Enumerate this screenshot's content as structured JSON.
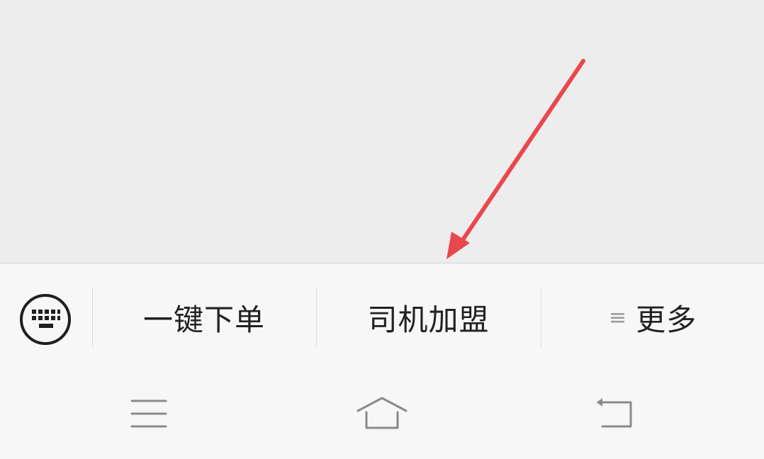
{
  "menu": {
    "items": [
      {
        "label": "一键下单"
      },
      {
        "label": "司机加盟"
      },
      {
        "label": "更多",
        "icon": "list-icon",
        "icon_glyph": "≡"
      }
    ],
    "keyboard_icon": "keyboard-icon"
  },
  "nav": {
    "menu_icon": "hamburger-menu-icon",
    "home_icon": "home-icon",
    "back_icon": "back-icon"
  },
  "annotation": {
    "arrow_color": "#e8484d"
  },
  "colors": {
    "content_bg": "#eeeded",
    "bar_bg": "#f7f7f7",
    "text": "#222222",
    "icon_gray": "#8a8a8a"
  }
}
